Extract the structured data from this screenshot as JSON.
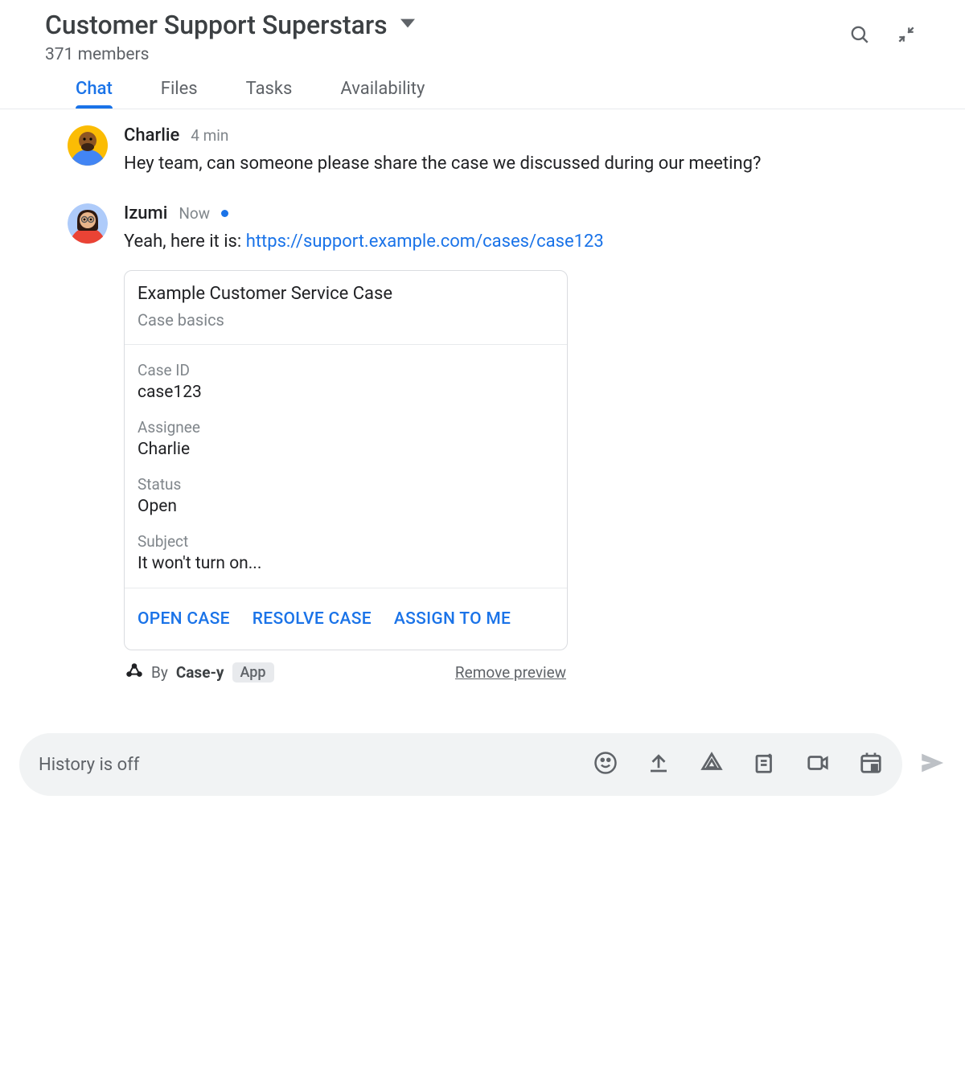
{
  "header": {
    "room_title": "Customer Support Superstars",
    "members_text": "371 members"
  },
  "tabs": [
    {
      "label": "Chat",
      "active": true
    },
    {
      "label": "Files",
      "active": false
    },
    {
      "label": "Tasks",
      "active": false
    },
    {
      "label": "Availability",
      "active": false
    }
  ],
  "messages": [
    {
      "author": "Charlie",
      "time": "4 min",
      "has_dot": false,
      "text": "Hey team, can someone please share the case we discussed during our meeting?",
      "link": null
    },
    {
      "author": "Izumi",
      "time": "Now",
      "has_dot": true,
      "text_prefix": "Yeah, here it is: ",
      "link": "https://support.example.com/cases/case123"
    }
  ],
  "card": {
    "title": "Example Customer Service Case",
    "subtitle": "Case basics",
    "fields": [
      {
        "label": "Case ID",
        "value": "case123"
      },
      {
        "label": "Assignee",
        "value": "Charlie"
      },
      {
        "label": "Status",
        "value": "Open"
      },
      {
        "label": "Subject",
        "value": "It won't turn on..."
      }
    ],
    "actions": [
      "OPEN CASE",
      "RESOLVE CASE",
      "ASSIGN TO ME"
    ],
    "footer": {
      "by_prefix": "By ",
      "app_name": "Case-y",
      "app_badge": "App",
      "remove_text": "Remove preview"
    }
  },
  "composer": {
    "placeholder": "History is off"
  }
}
